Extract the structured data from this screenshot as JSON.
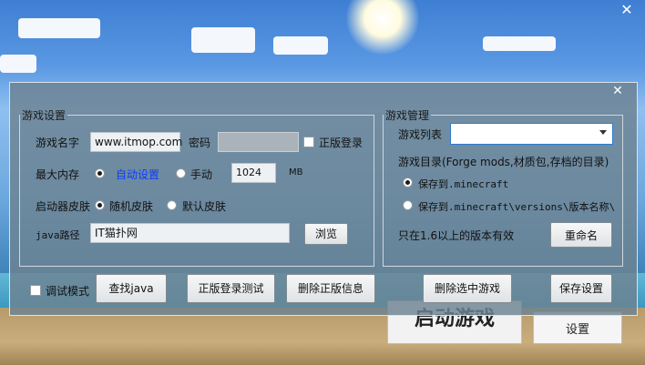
{
  "window": {
    "close_glyph": "✕"
  },
  "background": {
    "start_label": "启动游戏",
    "settings_label": "设置"
  },
  "dialog": {
    "close_glyph": "✕",
    "game_settings": {
      "legend": "游戏设置",
      "name_label": "游戏名字",
      "name_value": "www.itmop.com",
      "password_label": "密码",
      "premium_label": "正版登录",
      "memory_label": "最大内存",
      "memory_auto": "自动设置",
      "memory_manual": "手动",
      "memory_value": "1024",
      "memory_unit": "MB",
      "skin_label": "启动器皮肤",
      "skin_random": "随机皮肤",
      "skin_default": "默认皮肤",
      "java_label": "java路径",
      "java_value": "IT猫扑网",
      "browse_label": "浏览"
    },
    "game_manage": {
      "legend": "游戏管理",
      "list_label": "游戏列表",
      "dir_label": "游戏目录(Forge mods,材质包,存档的目录)",
      "save_minecraft": "保存到.minecraft",
      "save_versions": "保存到.minecraft\\versions\\版本名称\\",
      "note": "只在1.6以上的版本有效",
      "rename_label": "重命名"
    },
    "bottom": {
      "debug_label": "调试模式",
      "find_java": "查找java",
      "premium_test": "正版登录测试",
      "delete_premium": "删除正版信息",
      "delete_game": "删除选中游戏",
      "save_settings": "保存设置"
    }
  },
  "colors": {
    "accent": "#0a3cff",
    "dialog_bg": "#6c8291",
    "combo_border": "#2b7bd1"
  }
}
